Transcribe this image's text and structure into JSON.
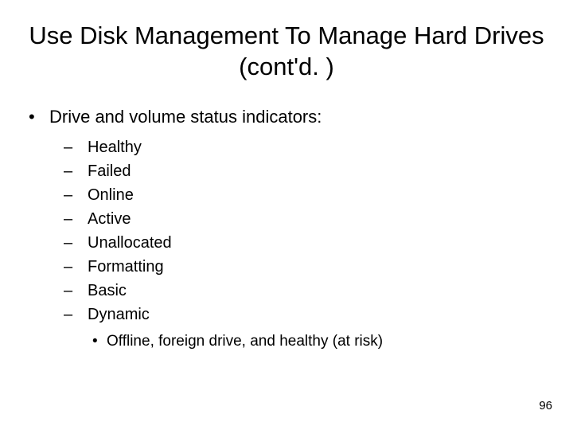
{
  "title": "Use Disk Management To Manage Hard Drives (cont'd. )",
  "bullets": {
    "lvl1": {
      "bullet": "•",
      "text": "Drive and volume status indicators:"
    },
    "lvl2": [
      {
        "bullet": "–",
        "text": "Healthy"
      },
      {
        "bullet": "–",
        "text": "Failed"
      },
      {
        "bullet": "–",
        "text": "Online"
      },
      {
        "bullet": "–",
        "text": "Active"
      },
      {
        "bullet": "–",
        "text": "Unallocated"
      },
      {
        "bullet": "–",
        "text": "Formatting"
      },
      {
        "bullet": "–",
        "text": "Basic"
      },
      {
        "bullet": "–",
        "text": "Dynamic"
      }
    ],
    "lvl3": {
      "bullet": "•",
      "text": "Offline, foreign drive, and healthy (at risk)"
    }
  },
  "page_number": "96"
}
